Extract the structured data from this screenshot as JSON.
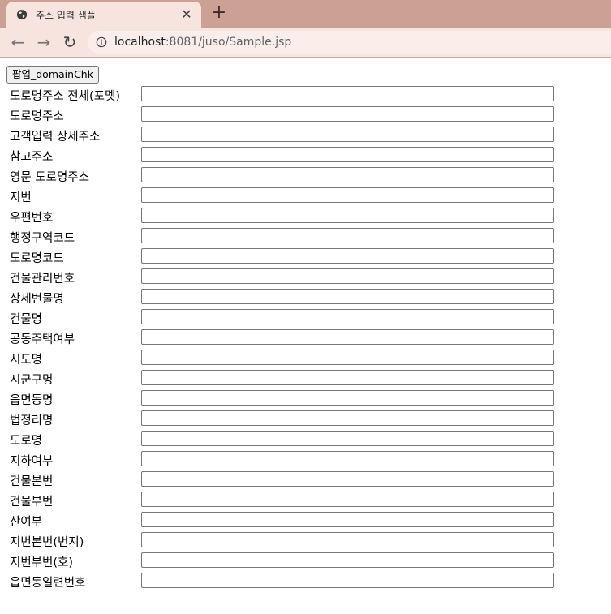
{
  "browser": {
    "tab": {
      "title": "주소 입력 샘플",
      "close_glyph": "✕",
      "favicon": "globe-icon"
    },
    "new_tab_glyph": "+",
    "nav": {
      "back_glyph": "←",
      "forward_glyph": "→",
      "reload_glyph": "↻"
    },
    "url_host": "localhost",
    "url_path": ":8081/juso/Sample.jsp",
    "colors": {
      "tabstrip": "#cda095",
      "toolbar": "#f7e4df"
    }
  },
  "page": {
    "popup_button_label": "팝업_domainChk",
    "fields": [
      {
        "label": "도로명주소 전체(포멧)",
        "value": ""
      },
      {
        "label": "도로명주소",
        "value": ""
      },
      {
        "label": "고객입력 상세주소",
        "value": ""
      },
      {
        "label": "참고주소",
        "value": ""
      },
      {
        "label": "영문 도로명주소",
        "value": ""
      },
      {
        "label": "지번",
        "value": ""
      },
      {
        "label": "우편번호",
        "value": ""
      },
      {
        "label": "행정구역코드",
        "value": ""
      },
      {
        "label": "도로명코드",
        "value": ""
      },
      {
        "label": "건물관리번호",
        "value": ""
      },
      {
        "label": "상세번물명",
        "value": ""
      },
      {
        "label": "건물명",
        "value": ""
      },
      {
        "label": "공동주택여부",
        "value": ""
      },
      {
        "label": "시도명",
        "value": ""
      },
      {
        "label": "시군구명",
        "value": ""
      },
      {
        "label": "읍면동명",
        "value": ""
      },
      {
        "label": "법정리명",
        "value": ""
      },
      {
        "label": "도로명",
        "value": ""
      },
      {
        "label": "지하여부",
        "value": ""
      },
      {
        "label": "건물본번",
        "value": ""
      },
      {
        "label": "건물부번",
        "value": ""
      },
      {
        "label": "산여부",
        "value": ""
      },
      {
        "label": "지번본번(번지)",
        "value": ""
      },
      {
        "label": "지번부번(호)",
        "value": ""
      },
      {
        "label": "읍면동일련번호",
        "value": ""
      }
    ]
  }
}
